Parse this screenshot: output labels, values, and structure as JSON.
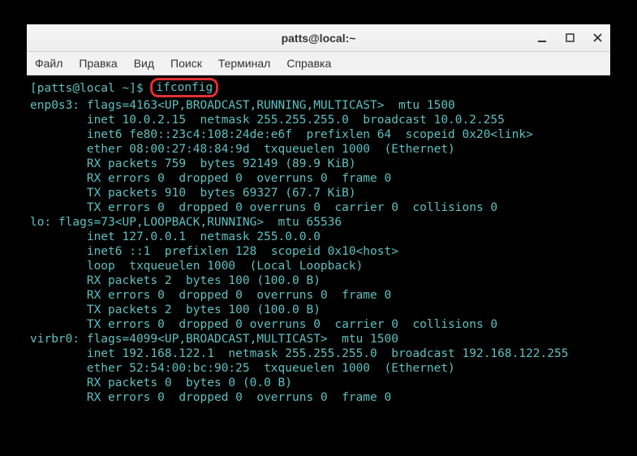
{
  "titlebar": {
    "title": "patts@local:~"
  },
  "menubar": {
    "items": [
      "Файл",
      "Правка",
      "Вид",
      "Поиск",
      "Терминал",
      "Справка"
    ]
  },
  "prompt": {
    "user_host": "[patts@local ~]$ ",
    "command": "ifconfig"
  },
  "output_lines": [
    "enp0s3: flags=4163<UP,BROADCAST,RUNNING,MULTICAST>  mtu 1500",
    "        inet 10.0.2.15  netmask 255.255.255.0  broadcast 10.0.2.255",
    "        inet6 fe80::23c4:108:24de:e6f  prefixlen 64  scopeid 0x20<link>",
    "        ether 08:00:27:48:84:9d  txqueuelen 1000  (Ethernet)",
    "        RX packets 759  bytes 92149 (89.9 KiB)",
    "        RX errors 0  dropped 0  overruns 0  frame 0",
    "        TX packets 910  bytes 69327 (67.7 KiB)",
    "        TX errors 0  dropped 0 overruns 0  carrier 0  collisions 0",
    "",
    "lo: flags=73<UP,LOOPBACK,RUNNING>  mtu 65536",
    "        inet 127.0.0.1  netmask 255.0.0.0",
    "        inet6 ::1  prefixlen 128  scopeid 0x10<host>",
    "        loop  txqueuelen 1000  (Local Loopback)",
    "        RX packets 2  bytes 100 (100.0 B)",
    "        RX errors 0  dropped 0  overruns 0  frame 0",
    "        TX packets 2  bytes 100 (100.0 B)",
    "        TX errors 0  dropped 0 overruns 0  carrier 0  collisions 0",
    "",
    "virbr0: flags=4099<UP,BROADCAST,MULTICAST>  mtu 1500",
    "        inet 192.168.122.1  netmask 255.255.255.0  broadcast 192.168.122.255",
    "        ether 52:54:00:bc:90:25  txqueuelen 1000  (Ethernet)",
    "        RX packets 0  bytes 0 (0.0 B)",
    "        RX errors 0  dropped 0  overruns 0  frame 0"
  ]
}
